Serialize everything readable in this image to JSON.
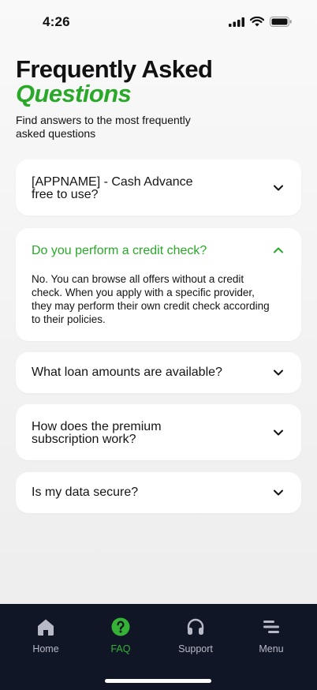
{
  "status_bar": {
    "time": "4:26"
  },
  "header": {
    "title_line1": "Frequently Asked",
    "title_line2": "Questions",
    "subtitle": "Find answers to the most frequently asked questions"
  },
  "faq": [
    {
      "question": "[APPNAME] - Cash Advance free to use?",
      "expanded": false
    },
    {
      "question": "Do you perform a credit check?",
      "expanded": true,
      "answer": "No. You can browse all offers without a credit check. When you apply with a specific provider, they may perform their own credit check according to their policies."
    },
    {
      "question": "What loan amounts are available?",
      "expanded": false
    },
    {
      "question": "How does the premium subscription work?",
      "expanded": false
    },
    {
      "question": "Is my data secure?",
      "expanded": false
    }
  ],
  "nav": {
    "items": [
      {
        "label": "Home",
        "icon": "home-icon",
        "active": false
      },
      {
        "label": "FAQ",
        "icon": "question-circle-icon",
        "active": true
      },
      {
        "label": "Support",
        "icon": "headphones-icon",
        "active": false
      },
      {
        "label": "Menu",
        "icon": "menu-icon",
        "active": false
      }
    ]
  },
  "colors": {
    "accent": "#29a829",
    "nav_background": "#111627",
    "nav_inactive": "#b7bac6"
  }
}
